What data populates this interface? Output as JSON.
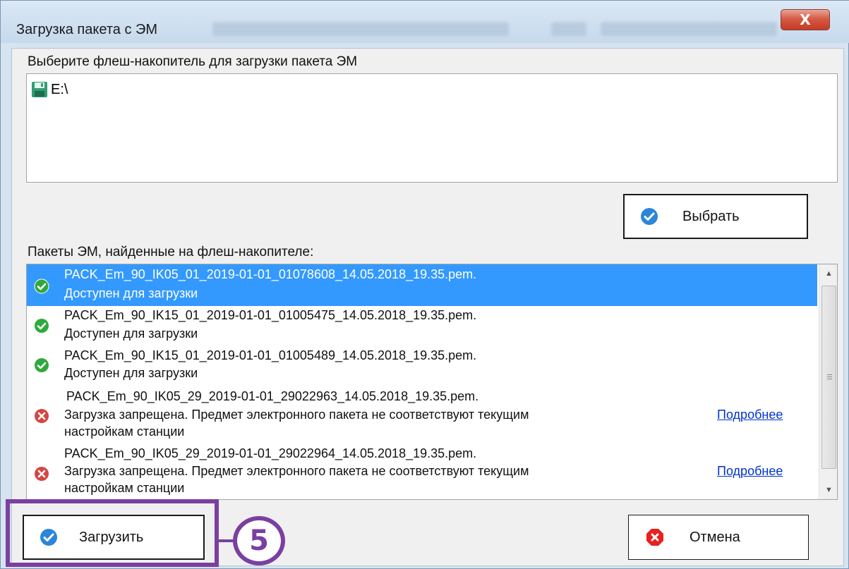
{
  "window": {
    "title": "Загрузка пакета с ЭМ",
    "close_label": "X"
  },
  "drives": {
    "prompt": "Выберите флеш-накопитель для загрузки пакета ЭМ",
    "items": [
      {
        "label": "E:\\",
        "icon": "floppy-disk-icon"
      }
    ],
    "select_button": "Выбрать"
  },
  "packages": {
    "header": "Пакеты ЭМ, найденные на флеш-накопителе:",
    "more_link": "Подробнее",
    "items": [
      {
        "name": "PACK_Em_90_IK05_01_2019-01-01_01078608_14.05.2018_19.35.pem.",
        "status_line1": "Доступен для загрузки",
        "status_line2": "",
        "ok": true,
        "selected": true
      },
      {
        "name": "PACK_Em_90_IK15_01_2019-01-01_01005475_14.05.2018_19.35.pem.",
        "status_line1": "Доступен для загрузки",
        "status_line2": "",
        "ok": true,
        "selected": false
      },
      {
        "name": "PACK_Em_90_IK15_01_2019-01-01_01005489_14.05.2018_19.35.pem.",
        "status_line1": "Доступен для загрузки",
        "status_line2": "",
        "ok": true,
        "selected": false
      },
      {
        "name": "PACK_Em_90_IK05_29_2019-01-01_29022963_14.05.2018_19.35.pem.",
        "status_line1": "Загрузка запрещена. Предмет электронного пакета не соответствуют текущим",
        "status_line2": "настройкам станции",
        "ok": false,
        "selected": false
      },
      {
        "name": "PACK_Em_90_IK05_29_2019-01-01_29022964_14.05.2018_19.35.pem.",
        "status_line1": "Загрузка запрещена. Предмет электронного пакета не соответствуют текущим",
        "status_line2": "настройкам станции",
        "ok": false,
        "selected": false
      }
    ]
  },
  "footer": {
    "load_button": "Загрузить",
    "cancel_button": "Отмена"
  },
  "annotation": {
    "step_number": "5",
    "color": "#7b3fa0"
  },
  "colors": {
    "selection": "#3399ff",
    "ok_green": "#2eaa3c",
    "error_red": "#d64541",
    "check_blue": "#2b86d9",
    "link_blue": "#0033cc"
  }
}
